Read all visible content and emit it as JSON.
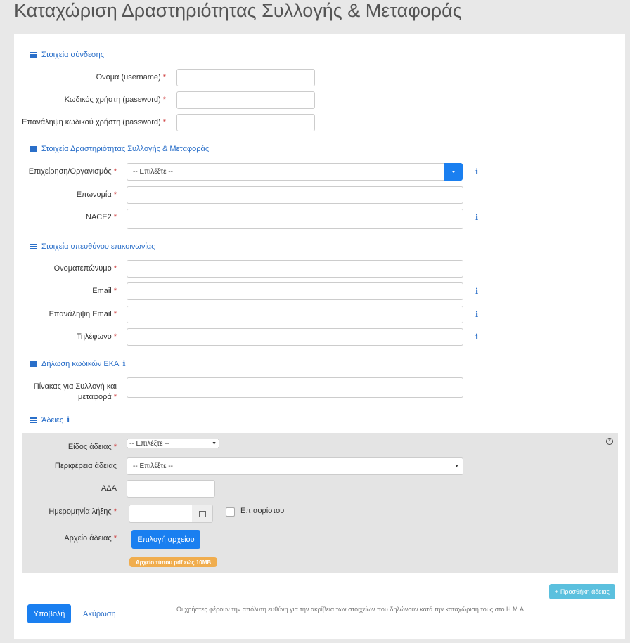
{
  "page_title": "Καταχώριση Δραστηριότητας Συλλογής & Μεταφοράς",
  "required_mark": "*",
  "sections": {
    "login": "Στοιχεία σύνδεσης",
    "activity": "Στοιχεία Δραστηριότητας Συλλογής & Μεταφοράς",
    "contact": "Στοιχεία υπευθύνου επικοινωνίας",
    "eka": "Δήλωση κωδικών ΕΚΑ",
    "permits": "Άδειες"
  },
  "fields": {
    "username": "Όνομα (username)",
    "password": "Κωδικός χρήστη (password)",
    "password_repeat": "Επανάληψη κωδικού χρήστη (password)",
    "company": "Επιχείρηση/Οργανισμός",
    "company_value": "-- Επιλέξτε --",
    "name": "Επωνυμία",
    "nace": "NACE2",
    "fullname": "Ονοματεπώνυμο",
    "email": "Email",
    "email_repeat": "Επανάληψη Email",
    "phone": "Τηλέφωνο",
    "eka_table_1": "Πίνακας για Συλλογή και",
    "eka_table_2": "μεταφορά",
    "permit_type": "Είδος άδειας",
    "permit_type_value": "-- Επιλέξτε --",
    "permit_region": "Περιφέρεια άδειας",
    "permit_region_value": "-- Επιλέξτε --",
    "ada": "ΑΔΑ",
    "expiry_date": "Ημερομηνία λήξης",
    "indefinite": "Επ αορίστου",
    "permit_file": "Αρχείο άδειας"
  },
  "info_glyph": "i",
  "buttons": {
    "choose_file": "Επιλογή αρχείου",
    "file_hint": "Αρχείο τύπου pdf εώς 10MB",
    "add_permit": "+ Προσθήκη άδειας",
    "submit": "Υποβολή",
    "cancel": "Ακύρωση"
  },
  "footer_note": "Οι χρήστες φέρουν την απόλυτη ευθύνη για την ακρίβεια των στοιχείων που δηλώνουν κατά την καταχώριση τους στο Η.Μ.Α.",
  "colors": {
    "primary": "#1a7ff0",
    "link": "#2a6fc9",
    "warning": "#f0ad4e",
    "info": "#5bc0de"
  }
}
